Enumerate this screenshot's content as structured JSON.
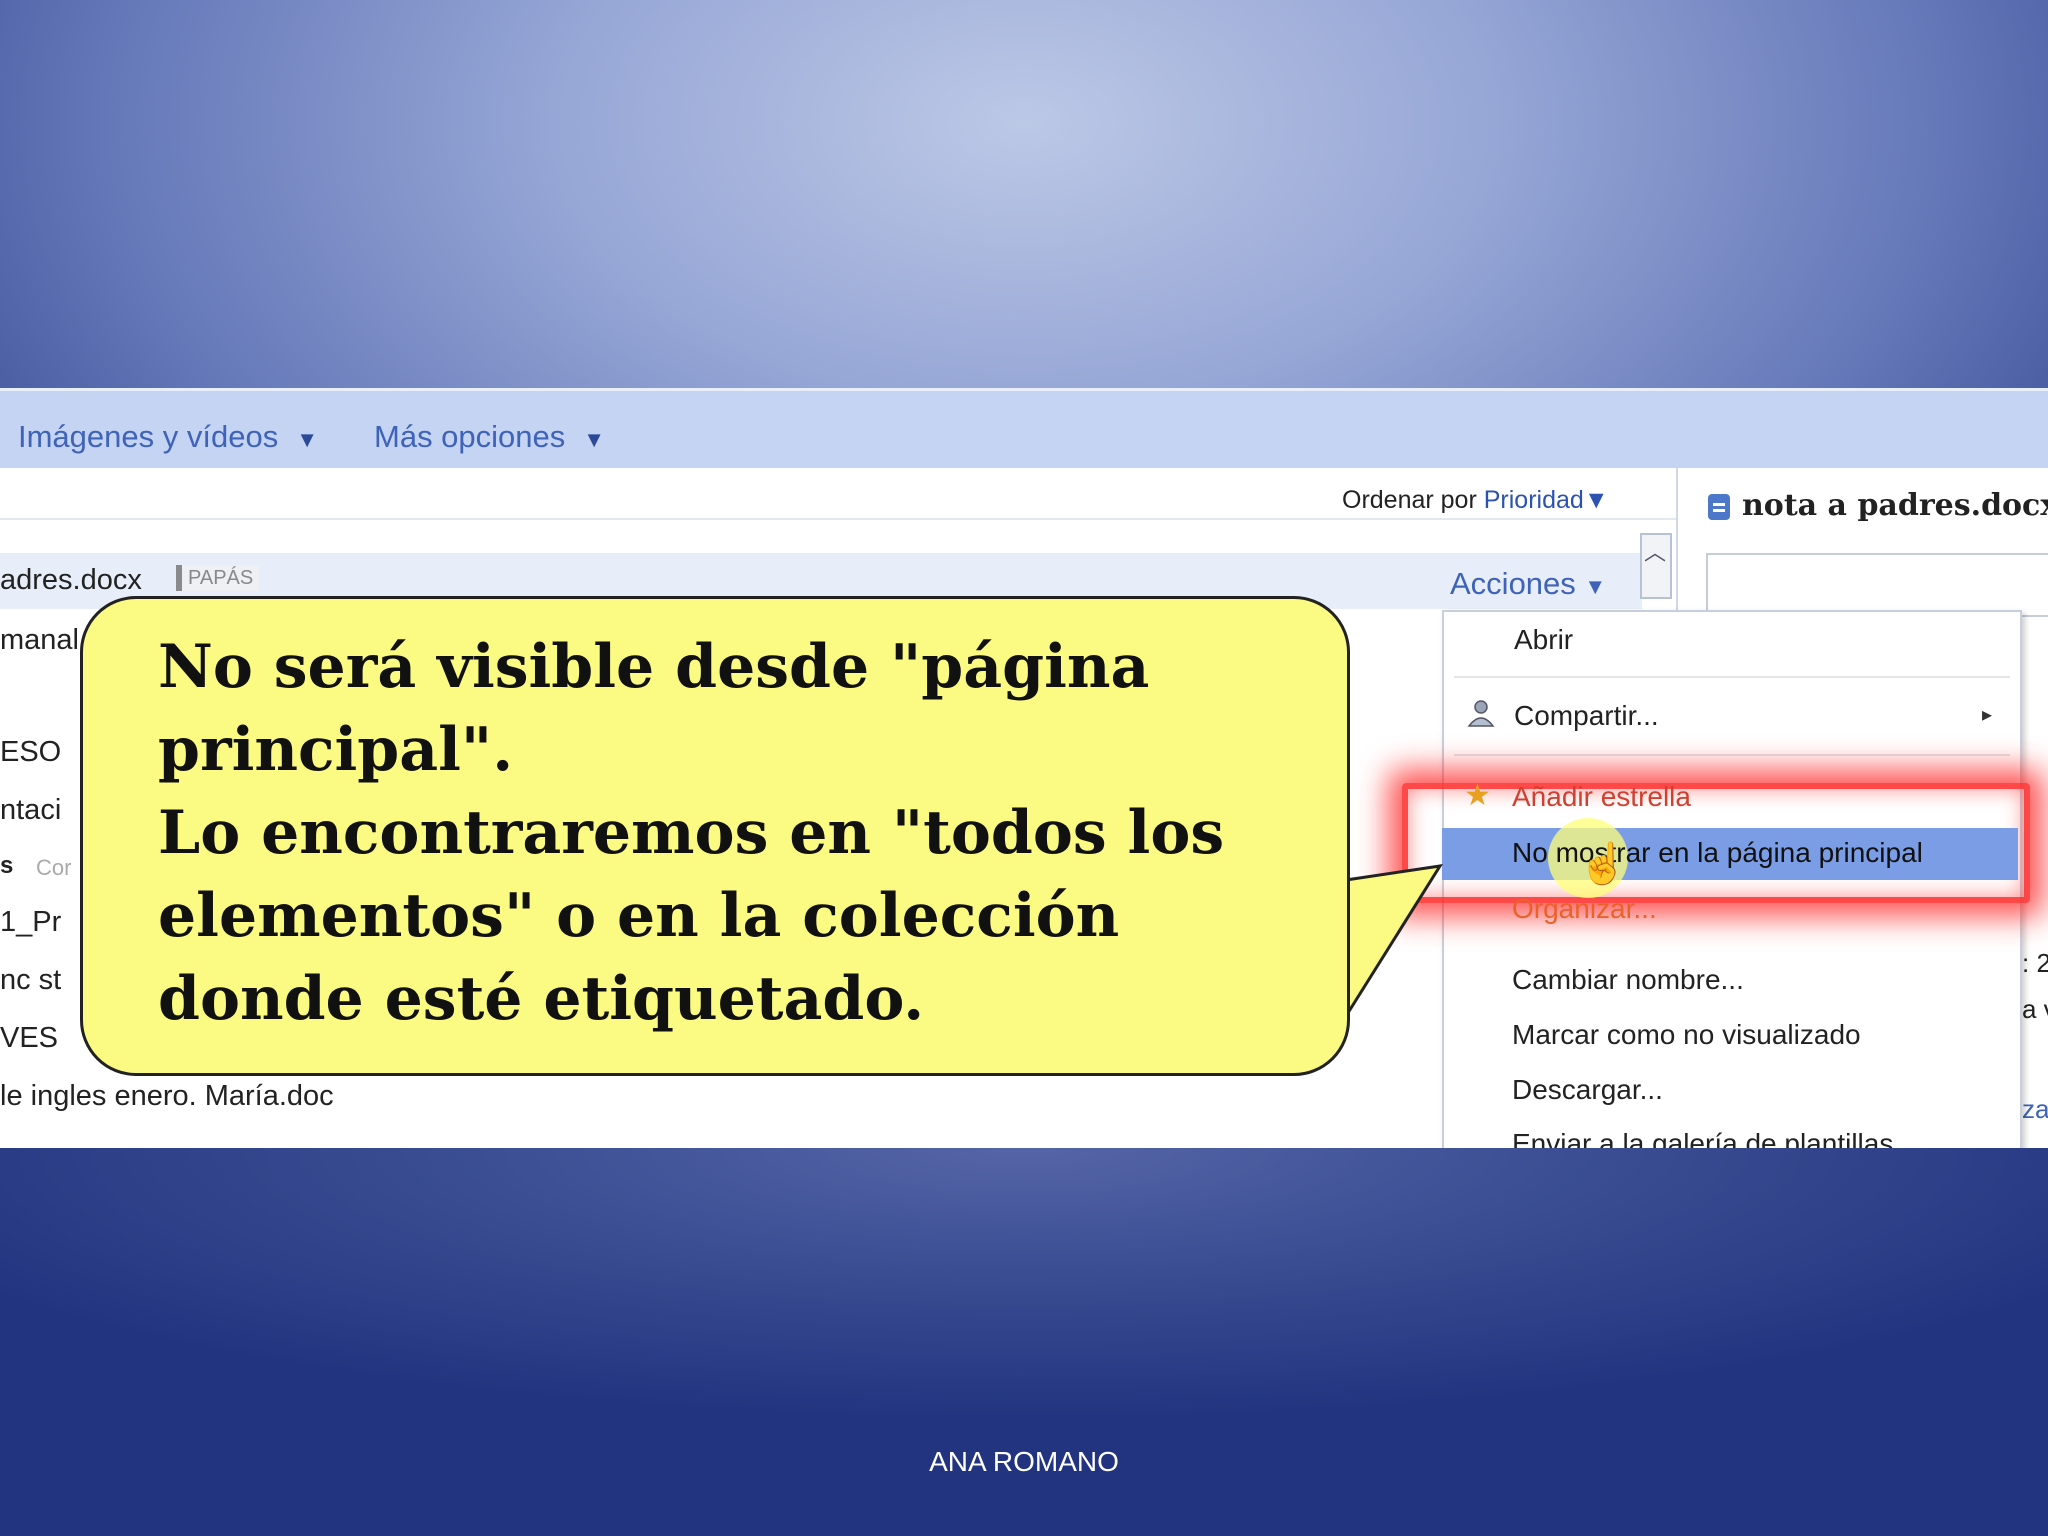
{
  "toolbar": {
    "images_videos": "Imágenes y vídeos",
    "more_options": "Más opciones",
    "dropdown_glyph": "▼"
  },
  "sort": {
    "label": "Ordenar por",
    "value": "Prioridad",
    "glyph": "▼"
  },
  "list": {
    "selected_file": "adres.docx",
    "selected_tag": "PAPÁS",
    "actions": "Acciones",
    "actions_glyph": "▼",
    "rows": [
      "manal",
      "ESO",
      "ntaci",
      "s",
      "1_Pr",
      "nc st",
      "VES",
      "le ingles enero. María.doc"
    ],
    "row_dim": "Cor"
  },
  "preview": {
    "title": "nota a padres.docx"
  },
  "right_edge": {
    "c1": ": 2",
    "c2": "a v",
    "c3": "za"
  },
  "menu": {
    "open": "Abrir",
    "share": "Compartir...",
    "star": "Añadir estrella",
    "hide_home": "No mostrar en la página principal",
    "organize": "Organizar...",
    "rename": "Cambiar nombre...",
    "mark_unviewed": "Marcar como no visualizado",
    "download": "Descargar...",
    "send_gallery": "Enviar a la galería de plantillas..."
  },
  "callout": {
    "line1": "No será visible desde \"página principal\".",
    "line2": "Lo encontraremos en \"todos los elementos\" o en la colección donde esté etiquetado."
  },
  "footer": {
    "author": "ANA ROMANO"
  },
  "colors": {
    "link_blue": "#3e63b8",
    "toolbar_bg": "#c5d4f3",
    "highlight": "#7a9de6",
    "callout_bg": "#fbfa83",
    "glow_red": "#ff2828"
  }
}
